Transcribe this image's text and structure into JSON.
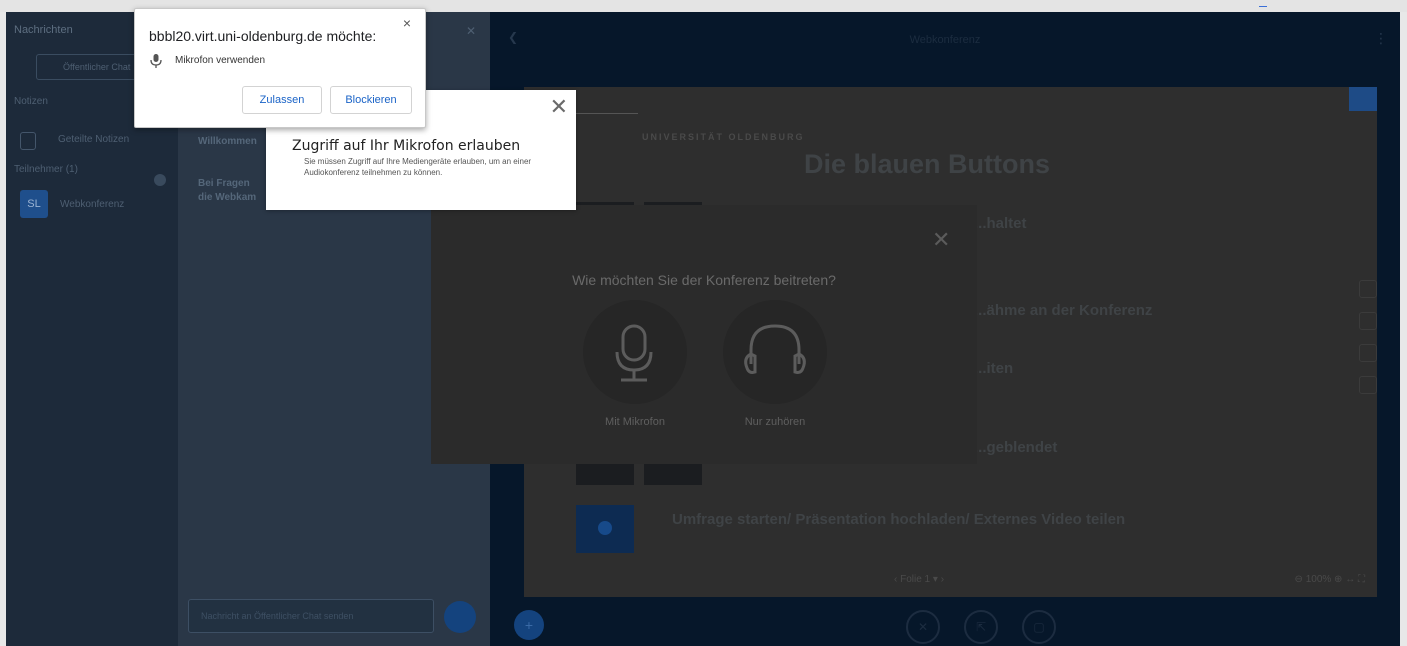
{
  "browser_prompt": {
    "title": "bbbl20.virt.uni-oldenburg.de möchte:",
    "permission": "Mikrofon verwenden",
    "allow_label": "Zulassen",
    "block_label": "Blockieren",
    "close_label": "×"
  },
  "mic_hint": {
    "title": "Zugriff auf Ihr Mikrofon erlauben",
    "text": "Sie müssen Zugriff auf Ihre Mediengeräte erlauben, um an einer Audiokonferenz teilnehmen zu können.",
    "close_label": "✕"
  },
  "join_modal": {
    "question": "Wie möchten Sie der Konferenz beitreten?",
    "close_label": "✕",
    "options": [
      {
        "label": "Mit Mikrofon",
        "icon": "microphone-icon"
      },
      {
        "label": "Nur zuhören",
        "icon": "headphones-icon"
      }
    ]
  },
  "sidebar": {
    "title": "Nachrichten",
    "search_placeholder": "Öffentlicher Chat",
    "section_notes": "Notizen",
    "note_label": "Geteilte Notizen",
    "section_users": "Teilnehmer (1)",
    "user_initials": "SL",
    "user_name": "Webkonferenz"
  },
  "chat": {
    "close_label": "✕",
    "msg1": "Willkommen",
    "msg2": "Bei Fragen",
    "msg3": "die Webkam",
    "input_placeholder": "Nachricht an Öffentlicher Chat senden"
  },
  "main": {
    "title": "Webkonferenz",
    "menu_label": "⋮",
    "arrow_label": "❮"
  },
  "slide": {
    "logo_text": "UNIVERSITÄT OLDENBURG",
    "title": "Die blauen Buttons",
    "items": [
      "...haltet",
      "...ähme an der Konferenz",
      "...iten",
      "...geblendet",
      "Umfrage starten/ Präsentation hochladen/ Externes Video teilen"
    ],
    "nav": "‹   Folie 1  ▾   ›",
    "zoom": "⊖   100%   ⊕   ↔   ⛶"
  },
  "actions": {
    "plus_label": "+",
    "buttons": [
      "✕",
      "⇱",
      "▢"
    ]
  },
  "colors": {
    "accent_blue": "#1a63c7",
    "app_bg": "#06172a"
  }
}
